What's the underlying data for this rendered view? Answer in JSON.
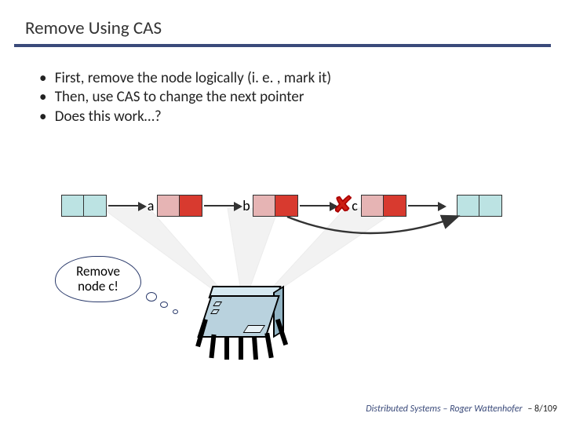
{
  "title": "Remove Using CAS",
  "bullets": [
    "First, remove the node logically (i. e. , mark it)",
    "Then, use CAS to change the next pointer",
    "Does this work…?"
  ],
  "nodes": {
    "head": "",
    "a": "a",
    "b": "b",
    "c": "c",
    "tail": ""
  },
  "thought": "Remove\nnode c!",
  "cross": "✘",
  "footer_course": "Distributed Systems",
  "footer_sep": " – ",
  "footer_author": "Roger Wattenhofer",
  "footer_page": " – 8/109"
}
